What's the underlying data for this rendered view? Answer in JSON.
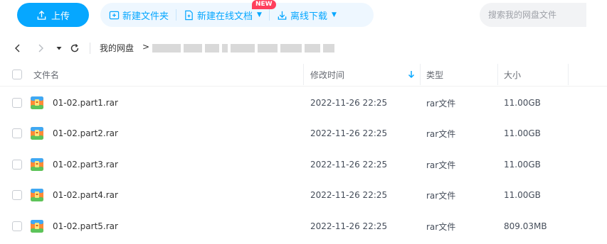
{
  "toolbar": {
    "upload_label": "上传",
    "new_folder_label": "新建文件夹",
    "new_online_doc_label": "新建在线文档",
    "new_badge": "NEW",
    "offline_download_label": "离线下载",
    "search_placeholder": "搜索我的网盘文件",
    "accent_color": "#06a7ff"
  },
  "breadcrumb": {
    "home": "我的网盘",
    "separator": ">"
  },
  "table": {
    "headers": {
      "name": "文件名",
      "modified": "修改时间",
      "type": "类型",
      "size": "大小"
    },
    "rows": [
      {
        "name": "01-02.part1.rar",
        "modified": "2022-11-26 22:25",
        "type": "rar文件",
        "size": "11.00GB"
      },
      {
        "name": "01-02.part2.rar",
        "modified": "2022-11-26 22:25",
        "type": "rar文件",
        "size": "11.00GB"
      },
      {
        "name": "01-02.part3.rar",
        "modified": "2022-11-26 22:25",
        "type": "rar文件",
        "size": "11.00GB"
      },
      {
        "name": "01-02.part4.rar",
        "modified": "2022-11-26 22:25",
        "type": "rar文件",
        "size": "11.00GB"
      },
      {
        "name": "01-02.part5.rar",
        "modified": "2022-11-26 22:25",
        "type": "rar文件",
        "size": "809.03MB"
      }
    ]
  },
  "icons": {
    "upload": "upload-icon",
    "new_folder": "folder-plus-icon",
    "new_doc": "document-plus-icon",
    "download": "download-icon",
    "back": "chevron-left-icon",
    "forward": "chevron-right-icon",
    "dropdown": "caret-down-icon",
    "refresh": "refresh-icon",
    "sort": "sort-descending-icon",
    "file": "rar-archive-icon"
  }
}
